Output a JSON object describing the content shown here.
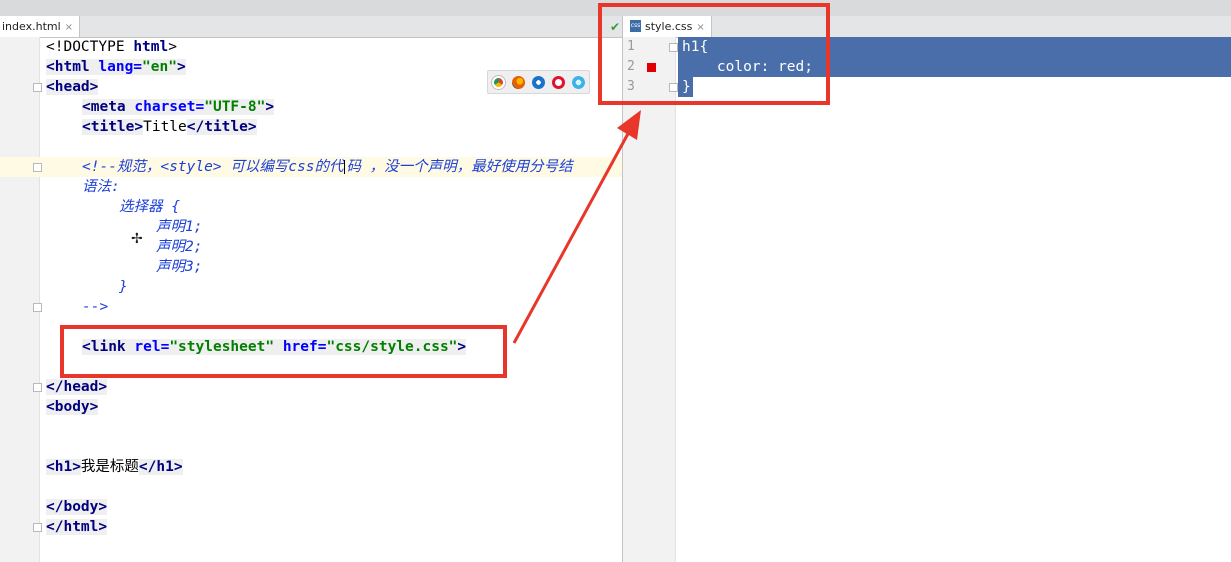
{
  "left_editor": {
    "tab": {
      "label": "index.html",
      "close": "×"
    },
    "lines": [
      {
        "p1": "<!DOCTYPE ",
        "p2": "html",
        "p3": ">"
      },
      {
        "p1": "<html ",
        "p2": "lang=",
        "p3": "\"en\"",
        "p4": ">"
      },
      {
        "p1": "<head",
        "p2": ">"
      },
      {
        "p1": "<meta ",
        "p2": "charset=",
        "p3": "\"UTF-8\"",
        "p4": ">"
      },
      {
        "p1": "<title>",
        "p2": "Title",
        "p3": "</title>"
      },
      {
        "a": "<!--规范，<style> 可以编写css的代",
        "b": "码 ，没一个声明，最好使用分号结"
      },
      {
        "t": "语法:"
      },
      {
        "t": "选择器 {"
      },
      {
        "t": "声明1;"
      },
      {
        "t": "声明2;"
      },
      {
        "t": "声明3;"
      },
      {
        "t": "}"
      },
      {
        "t": "-->"
      },
      {
        "p1": "<link ",
        "p2": "rel=",
        "p3": "\"stylesheet\" ",
        "p4": "href=",
        "p5": "\"css/style.css\"",
        "p6": ">"
      },
      {
        "t": "</head>"
      },
      {
        "t": "<body>"
      },
      {
        "p1": "<h1>",
        "p2": "我是标题",
        "p3": "</h1>"
      },
      {
        "t": "</body>"
      },
      {
        "t": "</html>"
      }
    ]
  },
  "right_editor": {
    "tab": {
      "label": "style.css",
      "close": "×",
      "icon": "css-file-icon"
    },
    "line_numbers": [
      "1",
      "2",
      "3"
    ],
    "lines": [
      "h1{",
      "    color: red;",
      "}"
    ],
    "color_swatch": "#e00000"
  },
  "annotation_color": "#e8362a",
  "browser_icons": [
    "chrome-icon",
    "firefox-icon",
    "ie-icon",
    "opera-icon",
    "safari-icon"
  ]
}
